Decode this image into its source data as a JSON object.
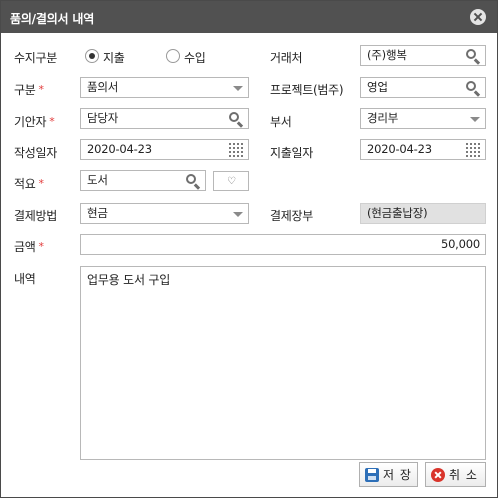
{
  "window": {
    "title": "품의/결의서 내역"
  },
  "labels": {
    "type": "수지구분",
    "client": "거래처",
    "category": "구분",
    "project": "프로젝트(범주)",
    "drafter": "기안자",
    "department": "부서",
    "created_date": "작성일자",
    "expense_date": "지출일자",
    "summary": "적요",
    "payment_method": "결제방법",
    "ledger": "결제장부",
    "amount": "금액",
    "details": "내역",
    "required_mark": "*"
  },
  "type_options": [
    {
      "label": "지출",
      "checked": true
    },
    {
      "label": "수입",
      "checked": false
    }
  ],
  "values": {
    "client": "(주)행복",
    "category": "품의서",
    "project": "영업",
    "drafter": "담당자",
    "department": "경리부",
    "created_date": "2020-04-23",
    "expense_date": "2020-04-23",
    "summary": "도서",
    "payment_method": "현금",
    "ledger": "(현금출납장)",
    "amount": "50,000",
    "details": "업무용 도서 구입"
  },
  "buttons": {
    "save": "저 장",
    "cancel": "취 소"
  },
  "icons": {
    "close": "close-icon",
    "search": "search-icon",
    "calendar": "calendar-icon",
    "favorite": "heart-icon",
    "save": "save-icon",
    "cancel": "cancel-icon"
  },
  "colors": {
    "titlebar": "#515151",
    "required": "#e23b3b",
    "readonly_bg": "#e1e1e1"
  }
}
